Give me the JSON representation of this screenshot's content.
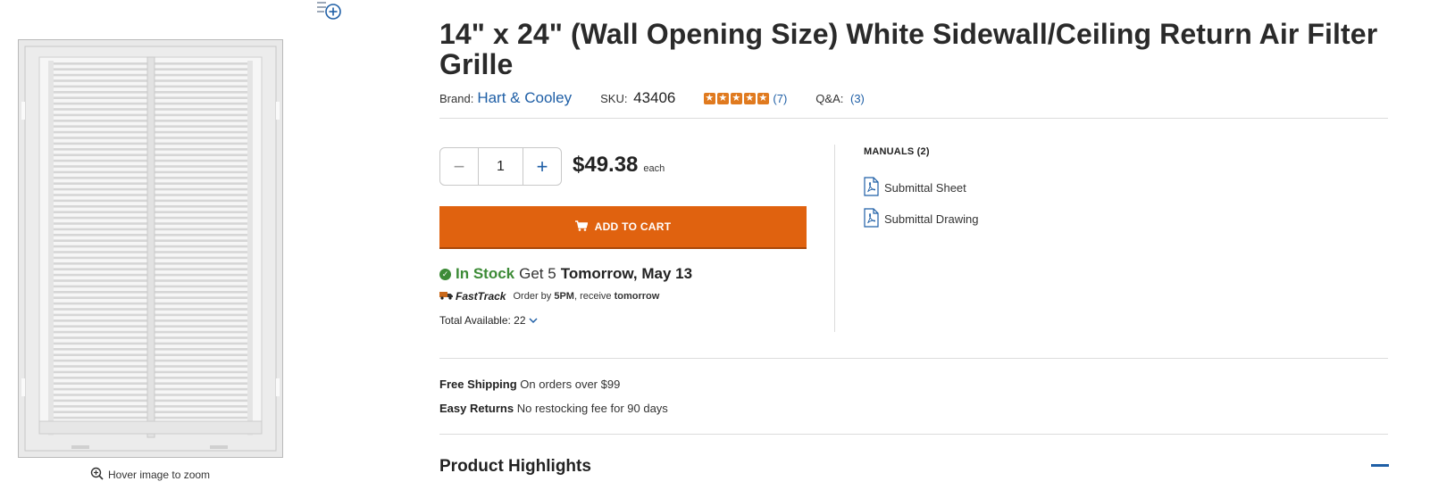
{
  "product": {
    "title": "14\" x 24\" (Wall Opening Size) White Sidewall/Ceiling Return Air Filter Grille",
    "brand_label": "Brand:",
    "brand": "Hart & Cooley",
    "sku_label": "SKU:",
    "sku": "43406",
    "rating_stars": 5,
    "review_count": "(7)",
    "qa_label": "Q&A:",
    "qa_count": "(3)"
  },
  "image": {
    "zoom_hint": "Hover image to zoom",
    "icons": [
      "add-to-list-icon",
      "zoom-icon"
    ]
  },
  "purchase": {
    "quantity": "1",
    "minus_label": "−",
    "plus_label": "+",
    "price": "$49.38",
    "price_unit": "each",
    "add_to_cart": "ADD TO CART",
    "in_stock": "In Stock",
    "get_text": "Get 5",
    "get_date": "Tomorrow, May 13",
    "fasttrack_logo": "FastTrack",
    "fasttrack_text_1": "Order by",
    "fasttrack_time": "5PM",
    "fasttrack_text_2": ", receive",
    "fasttrack_when": "tomorrow",
    "total_available": "Total Available: 22"
  },
  "manuals": {
    "title": "MANUALS (2)",
    "items": [
      {
        "label": "Submittal Sheet"
      },
      {
        "label": "Submittal Drawing"
      }
    ]
  },
  "shipping": {
    "free_label": "Free Shipping",
    "free_text": "On orders over $99",
    "returns_label": "Easy Returns",
    "returns_text": "No restocking fee for 90 days"
  },
  "highlights": {
    "title": "Product Highlights"
  },
  "colors": {
    "accent_orange": "#e0620f",
    "link_blue": "#1f5fa6",
    "stock_green": "#3d8b37",
    "star_orange": "#e07a1f"
  }
}
